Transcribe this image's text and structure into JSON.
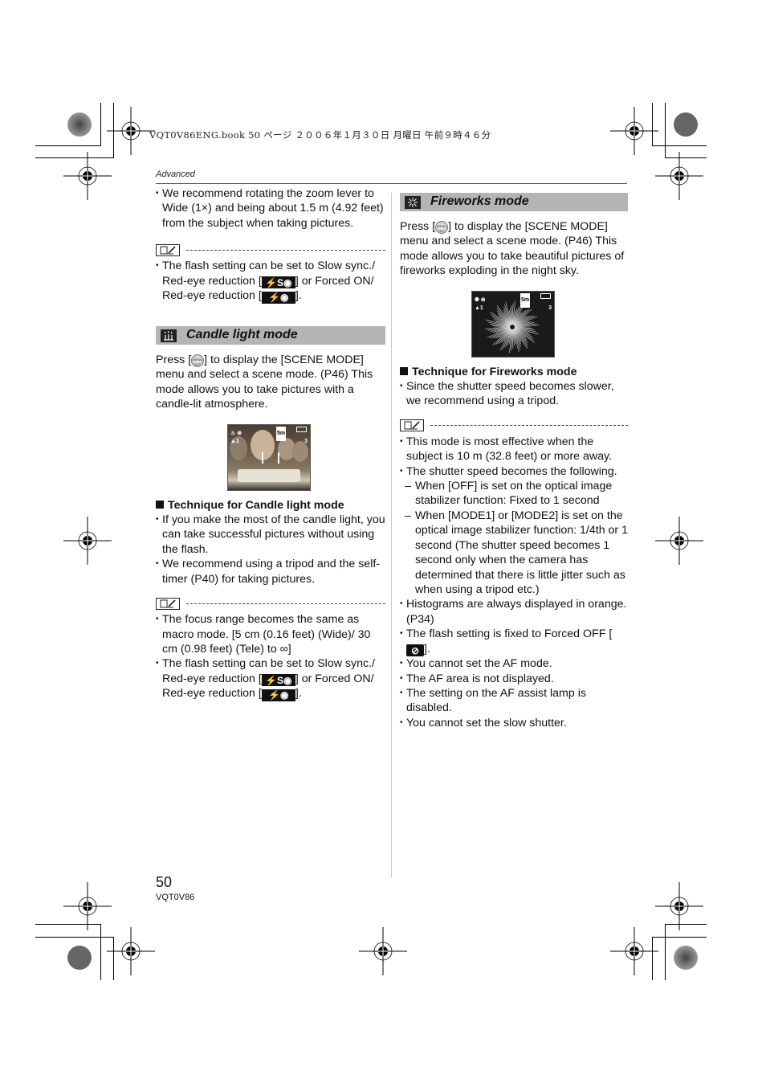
{
  "print_header": "VQT0V86ENG.book   50 ページ   ２００６年１月３０日   月曜日   午前９時４６分",
  "section_label": "Advanced",
  "left_column": {
    "intro_bullets": [
      "We recommend rotating the zoom lever to Wide (1×) and being about 1.5 m (4.92 feet) from the subject when taking pictures."
    ],
    "note1": {
      "icon": "note-icon",
      "bullet_parts": [
        "The flash setting can be set to Slow sync./ Red-eye reduction [",
        "] or Forced ON/ Red-eye reduction [",
        "]."
      ],
      "flash_icon_1": "⚡S◉",
      "flash_icon_2": "⚡◉"
    },
    "candle": {
      "title": "Candle light mode",
      "icon": "candle-icon",
      "intro_before": "Press [",
      "menu_button": "MENU/SET",
      "intro_after": "] to display the [SCENE MODE] menu and select a scene mode. (P46) This mode allows you to take pictures with a candle-lit atmosphere.",
      "photo": {
        "alt": "Candle light mode sample: children blowing out birthday cake candles",
        "shots_remaining": "3",
        "hud_size": "5m"
      },
      "technique_title": "Technique for Candle light mode",
      "technique_bullets": [
        "If you make the most of the candle light, you can take successful pictures without using the flash.",
        "We recommend using a tripod and the self-timer (P40) for taking pictures."
      ],
      "note": {
        "bullets": [
          "The focus range becomes the same as macro mode. [5 cm (0.16 feet) (Wide)/ 30 cm (0.98 feet) (Tele) to ∞]"
        ],
        "flash_bullet_parts": [
          "The flash setting can be set to Slow sync./ Red-eye reduction [",
          "] or Forced ON/ Red-eye reduction [",
          "]."
        ],
        "flash_icon_1": "⚡S◉",
        "flash_icon_2": "⚡◉"
      }
    }
  },
  "right_column": {
    "fireworks": {
      "title": "Fireworks mode",
      "icon": "fireworks-icon",
      "intro_before": "Press [",
      "menu_button": "MENU/SET",
      "intro_after": "] to display the [SCENE MODE] menu and select a scene mode. (P46) This mode allows you to take beautiful pictures of fireworks exploding in the night sky.",
      "photo": {
        "alt": "Fireworks mode sample: white firework burst on dark sky",
        "shots_remaining": "3",
        "hud_size": "5m"
      },
      "technique_title": "Technique for Fireworks mode",
      "technique_bullets": [
        "Since the shutter speed becomes slower, we recommend using a tripod."
      ],
      "note": {
        "bullet_1": "This mode is most effective when the subject is 10 m (32.8 feet) or more away.",
        "bullet_2": "The shutter speed becomes the following.",
        "sub_items": [
          "When [OFF] is set on the optical image stabilizer function:  Fixed to 1 second",
          "When [MODE1] or [MODE2] is set on the optical image stabilizer function: 1/4th or 1 second (The shutter speed becomes 1 second only when the camera has determined that there is little jitter such as when using a tripod etc.)"
        ],
        "bullet_3": "Histograms are always displayed in orange. (P34)",
        "flash_off_parts": [
          "The flash setting is fixed to Forced OFF [",
          "]."
        ],
        "flash_off_icon": "⊘",
        "remaining_bullets": [
          "You cannot set the AF mode.",
          "The AF area is not displayed.",
          "The setting on the AF assist lamp is disabled.",
          "You cannot set the slow shutter."
        ]
      }
    }
  },
  "footer": {
    "page_number": "50",
    "doc_code": "VQT0V86"
  },
  "colors": {
    "section_title_bg": "#b4b4b4",
    "rule": "#555555",
    "divider": "#c8c8c8"
  }
}
